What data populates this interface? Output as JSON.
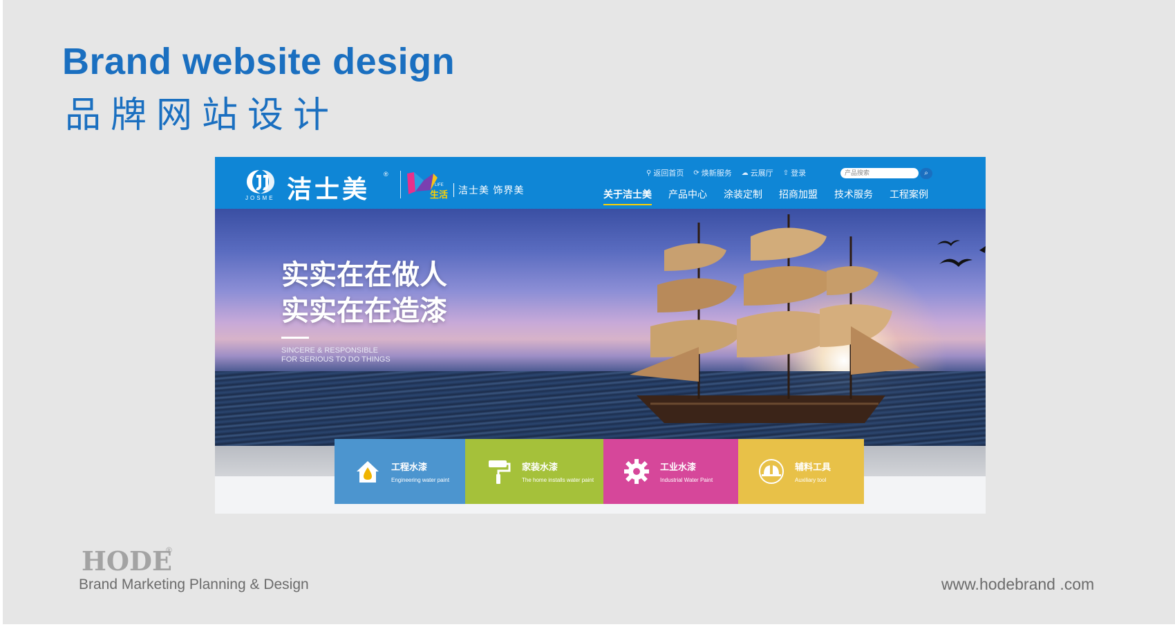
{
  "slide": {
    "title_en": "Brand website design",
    "title_cn": "品牌网站设计"
  },
  "site": {
    "logo": {
      "name": "洁士美",
      "sub": "JOSME",
      "reg": "®"
    },
    "life_badge": {
      "small": "LIFE",
      "cn": "生活"
    },
    "slogan": "洁士美 饰界美",
    "util_links": [
      {
        "icon": "location-pin-icon",
        "label": "返回首页"
      },
      {
        "icon": "refresh-icon",
        "label": "焕新服务"
      },
      {
        "icon": "cloud-icon",
        "label": "云展厅"
      },
      {
        "icon": "user-login-icon",
        "label": "登录"
      }
    ],
    "search": {
      "placeholder": "产品搜索"
    },
    "nav": [
      {
        "label": "关于洁士美",
        "active": true
      },
      {
        "label": "产品中心"
      },
      {
        "label": "涂装定制"
      },
      {
        "label": "招商加盟"
      },
      {
        "label": "技术服务"
      },
      {
        "label": "工程案例"
      }
    ],
    "hero": {
      "line1": "实实在在做人",
      "line2": "实实在在造漆",
      "sub1": "SINCERE & RESPONSIBLE",
      "sub2": "FOR SERIOUS TO DO THINGS"
    },
    "categories": [
      {
        "cn": "工程水漆",
        "en": "Engineering water paint",
        "color": "#4c95cf",
        "icon": "house-drop-icon"
      },
      {
        "cn": "家装水漆",
        "en": "The home installs water paint",
        "color": "#a5c13a",
        "icon": "paint-roller-icon"
      },
      {
        "cn": "工业水漆",
        "en": "Industrial Water Paint",
        "color": "#d6479a",
        "icon": "gear-icon"
      },
      {
        "cn": "辅料工具",
        "en": "Auxiliary tool",
        "color": "#e8c148",
        "icon": "helmet-icon"
      }
    ]
  },
  "footer": {
    "brand": "HODE",
    "reg": "®",
    "tagline": "Brand Marketing Planning &  Design",
    "url": "www.hodebrand .com"
  },
  "colors": {
    "accent": "#1a6fc0",
    "header_blue": "#0f86d6",
    "nav_underline": "#ffd200",
    "footer_gray": "#6b6b6b"
  }
}
